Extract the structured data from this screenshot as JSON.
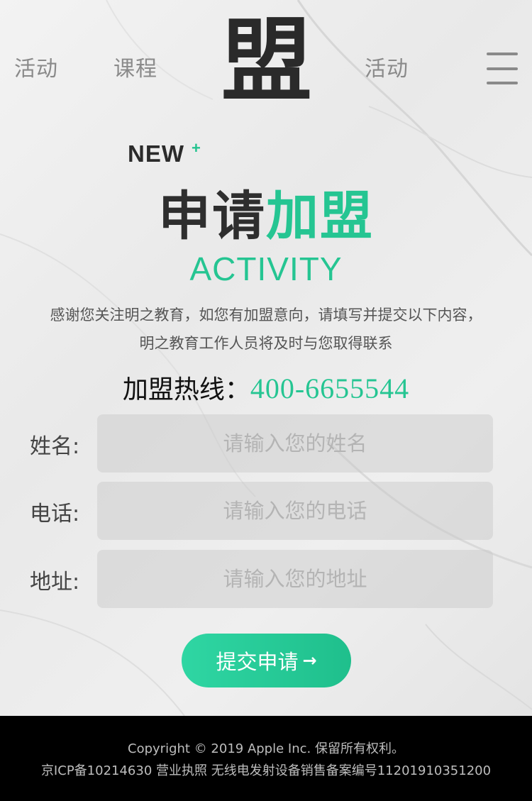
{
  "nav": {
    "left_items": [
      "活动",
      "课程"
    ],
    "right_item": "活动",
    "logo_text": "盟",
    "menu_icon": "hamburger-icon"
  },
  "hero": {
    "new_tag": "NEW",
    "new_plus": "+",
    "title_dark": "申请",
    "title_green": "加盟",
    "subtitle": "ACTIVITY",
    "intro_line1": "感谢您关注明之教育，如您有加盟意向，请填写并提交以下内容，",
    "intro_line2": "明之教育工作人员将及时与您取得联系",
    "hotline_label": "加盟热线：",
    "hotline_number": "400-6655544"
  },
  "form": {
    "name_label": "姓名:",
    "name_placeholder": "请输入您的姓名",
    "phone_label": "电话:",
    "phone_placeholder": "请输入您的电话",
    "address_label": "地址:",
    "address_placeholder": "请输入您的地址",
    "submit_label": "提交申请",
    "submit_icon": "→"
  },
  "footer": {
    "copyright": "Copyright © 2019 Apple Inc. 保留所有权利。",
    "icp": "京ICP备10214630 营业执照 无线电发射设备销售备案编号11201910351200"
  },
  "colors": {
    "accent": "#25c592",
    "footer_bg": "#000000",
    "text_dark": "#2e2e2e"
  }
}
